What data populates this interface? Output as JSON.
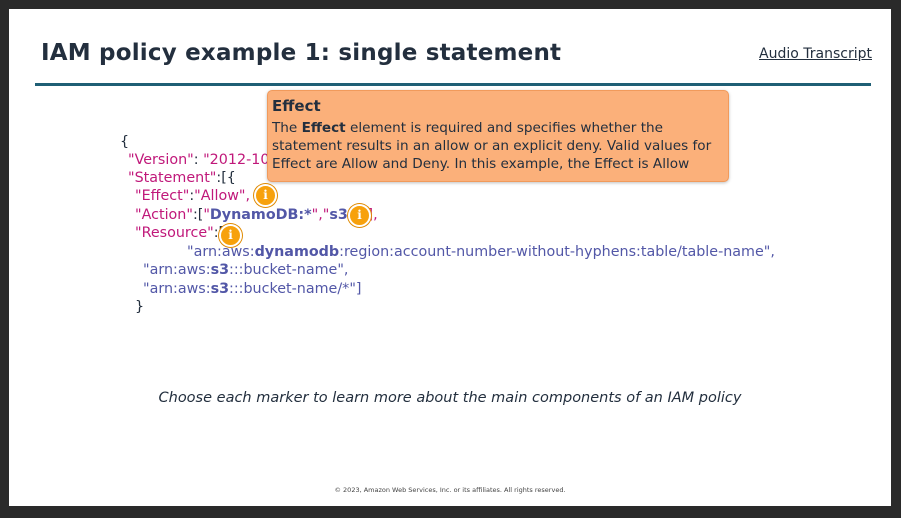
{
  "header": {
    "title": "IAM policy example 1: single statement",
    "transcript_link": "Audio Transcript"
  },
  "policy": {
    "open_brace": "{",
    "version_key": "\"Version\"",
    "version_sep": ": ",
    "version_value": "\"2012-10-",
    "statement_key": "\"Statement\"",
    "statement_sep": ":[{",
    "effect_key": "\"Effect\"",
    "effect_sep": ":",
    "effect_value": "\"Allow\",",
    "action_key": "\"Action\"",
    "action_sep": ":[",
    "action_q1": "\"",
    "action_v1": "DynamoDB:*",
    "action_q2": "\",\"",
    "action_v2": "s3:*",
    "action_q3": "\"],",
    "resource_key": "\"Resource\"",
    "resource_sep": ":[",
    "res1_a": "\"arn:aws:",
    "res1_b": "dynamodb",
    "res1_c": ":region:account-number-without-hyphens:table/table-name\",",
    "res2_a": "\"arn:aws:",
    "res2_b": "s3",
    "res2_c": ":::bucket-name\",",
    "res3_a": "\"arn:aws:",
    "res3_b": "s3",
    "res3_c": ":::bucket-name/*\"]",
    "close_brace": "}"
  },
  "markers": {
    "effect": "i",
    "action": "i",
    "resource": "i"
  },
  "tooltip": {
    "title": "Effect",
    "body_prefix": "The ",
    "body_bold": "Effect",
    "body_rest": " element is required and specifies whether the statement results in an allow or an explicit deny. Valid values for Effect are Allow and Deny. In this example, the Effect is Allow"
  },
  "hint": "Choose each marker to learn more about the main components of an IAM policy",
  "footer": {
    "copyright": "© 2023, Amazon Web Services, Inc. or its affiliates. All rights reserved."
  },
  "colors": {
    "title": "#232f3e",
    "rule": "#1f5f75",
    "key": "#c0187a",
    "value": "#5257a7",
    "marker": "#f7a10c",
    "tooltip_bg": "#fbb07a"
  }
}
